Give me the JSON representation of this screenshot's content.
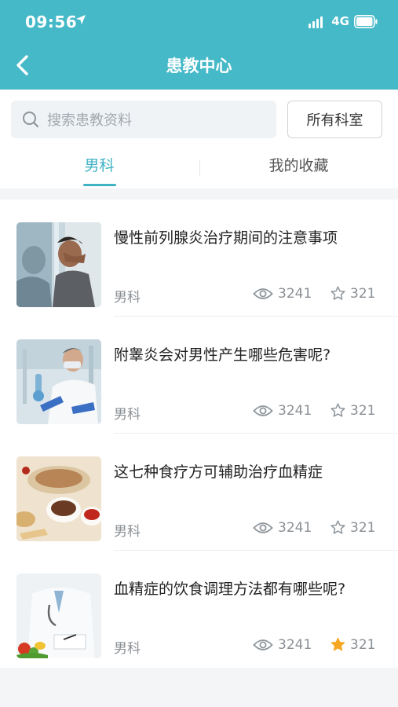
{
  "status_bar": {
    "time": "09:56",
    "network": "4G"
  },
  "nav": {
    "title": "患教中心"
  },
  "search": {
    "placeholder": "搜索患教资料"
  },
  "department_button": {
    "label": "所有科室"
  },
  "tabs": [
    {
      "label": "男科",
      "active": true
    },
    {
      "label": "我的收藏",
      "active": false
    }
  ],
  "articles": [
    {
      "title": "慢性前列腺炎治疗期间的注意事项",
      "department": "男科",
      "views": "3241",
      "favorites": "321",
      "favorited": false,
      "image": "stressed-man-photo"
    },
    {
      "title": "附睾炎会对男性产生哪些危害呢?",
      "department": "男科",
      "views": "3241",
      "favorites": "321",
      "favorited": false,
      "image": "lab-scientist-photo"
    },
    {
      "title": "这七种食疗方可辅助治疗血精症",
      "department": "男科",
      "views": "3241",
      "favorites": "321",
      "favorited": false,
      "image": "herbal-food-photo"
    },
    {
      "title": "血精症的饮食调理方法都有哪些呢?",
      "department": "男科",
      "views": "3241",
      "favorites": "321",
      "favorited": true,
      "image": "doctor-writing-photo"
    }
  ],
  "colors": {
    "accent": "#45b9c8",
    "tab_active": "#3fb3c3",
    "star_active": "#f5a623"
  }
}
